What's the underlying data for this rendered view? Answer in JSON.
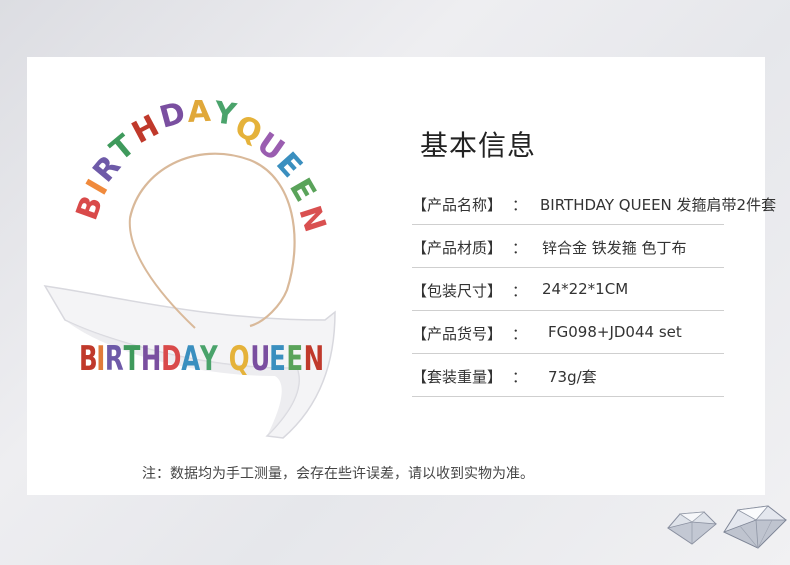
{
  "header": {
    "title": "基本信息"
  },
  "product_image": {
    "tiara_text": "BIRTHDAY QUEEN",
    "sash_text": "BIRTHDAY QUEEN",
    "letter_colors": [
      "#d94a4a",
      "#f08a3c",
      "#6e5aa8",
      "#3f9a5c",
      "#c0392b",
      "#7a4fa0",
      "#e0a83a",
      "#4aa36b",
      "#e27a3f",
      "#9a5db0",
      "#3a8fbf",
      "#d95050",
      "#e5b23a",
      "#5aa35a"
    ]
  },
  "specs": [
    {
      "key": "【产品名称】",
      "sep": "：",
      "value": "BIRTHDAY QUEEN 发箍肩带2件套"
    },
    {
      "key": "【产品材质】",
      "sep": "：",
      "value": "锌合金 铁发箍 色丁布"
    },
    {
      "key": "【包装尺寸】",
      "sep": "：",
      "value": "24*22*1CM"
    },
    {
      "key": "【产品货号】",
      "sep": "：",
      "value": "FG098+JD044 set"
    },
    {
      "key": "【套装重量】",
      "sep": "：",
      "value": "73g/套"
    }
  ],
  "note": "注：数据均为手工测量，会存在些许误差，请以收到实物为准。"
}
